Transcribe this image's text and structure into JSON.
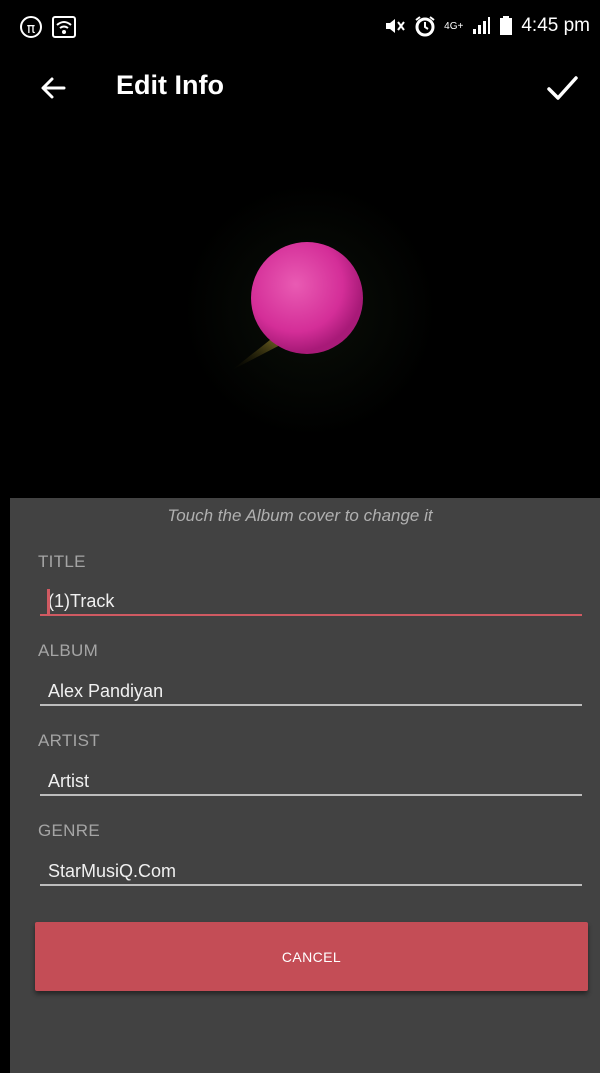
{
  "status_bar": {
    "time": "4:45 pm",
    "network_label": "4G+",
    "icons": [
      "pi-icon",
      "wifi-icon",
      "mute-icon",
      "alarm-icon",
      "signal-icon",
      "battery-icon"
    ]
  },
  "toolbar": {
    "title": "Edit Info",
    "back_icon": "back-arrow-icon",
    "confirm_icon": "check-icon"
  },
  "album": {
    "hint": "Touch the Album cover to change it"
  },
  "form": {
    "title_label": "TITLE",
    "title_value": "(1)Track",
    "album_label": "ALBUM",
    "album_value": "Alex Pandiyan",
    "artist_label": "ARTIST",
    "artist_value": "Artist",
    "genre_label": "GENRE",
    "genre_value": "StarMusiQ.Com"
  },
  "actions": {
    "cancel_label": "CANCEL"
  },
  "colors": {
    "accent": "#c44d56",
    "panel": "#424242",
    "background": "#000000"
  }
}
